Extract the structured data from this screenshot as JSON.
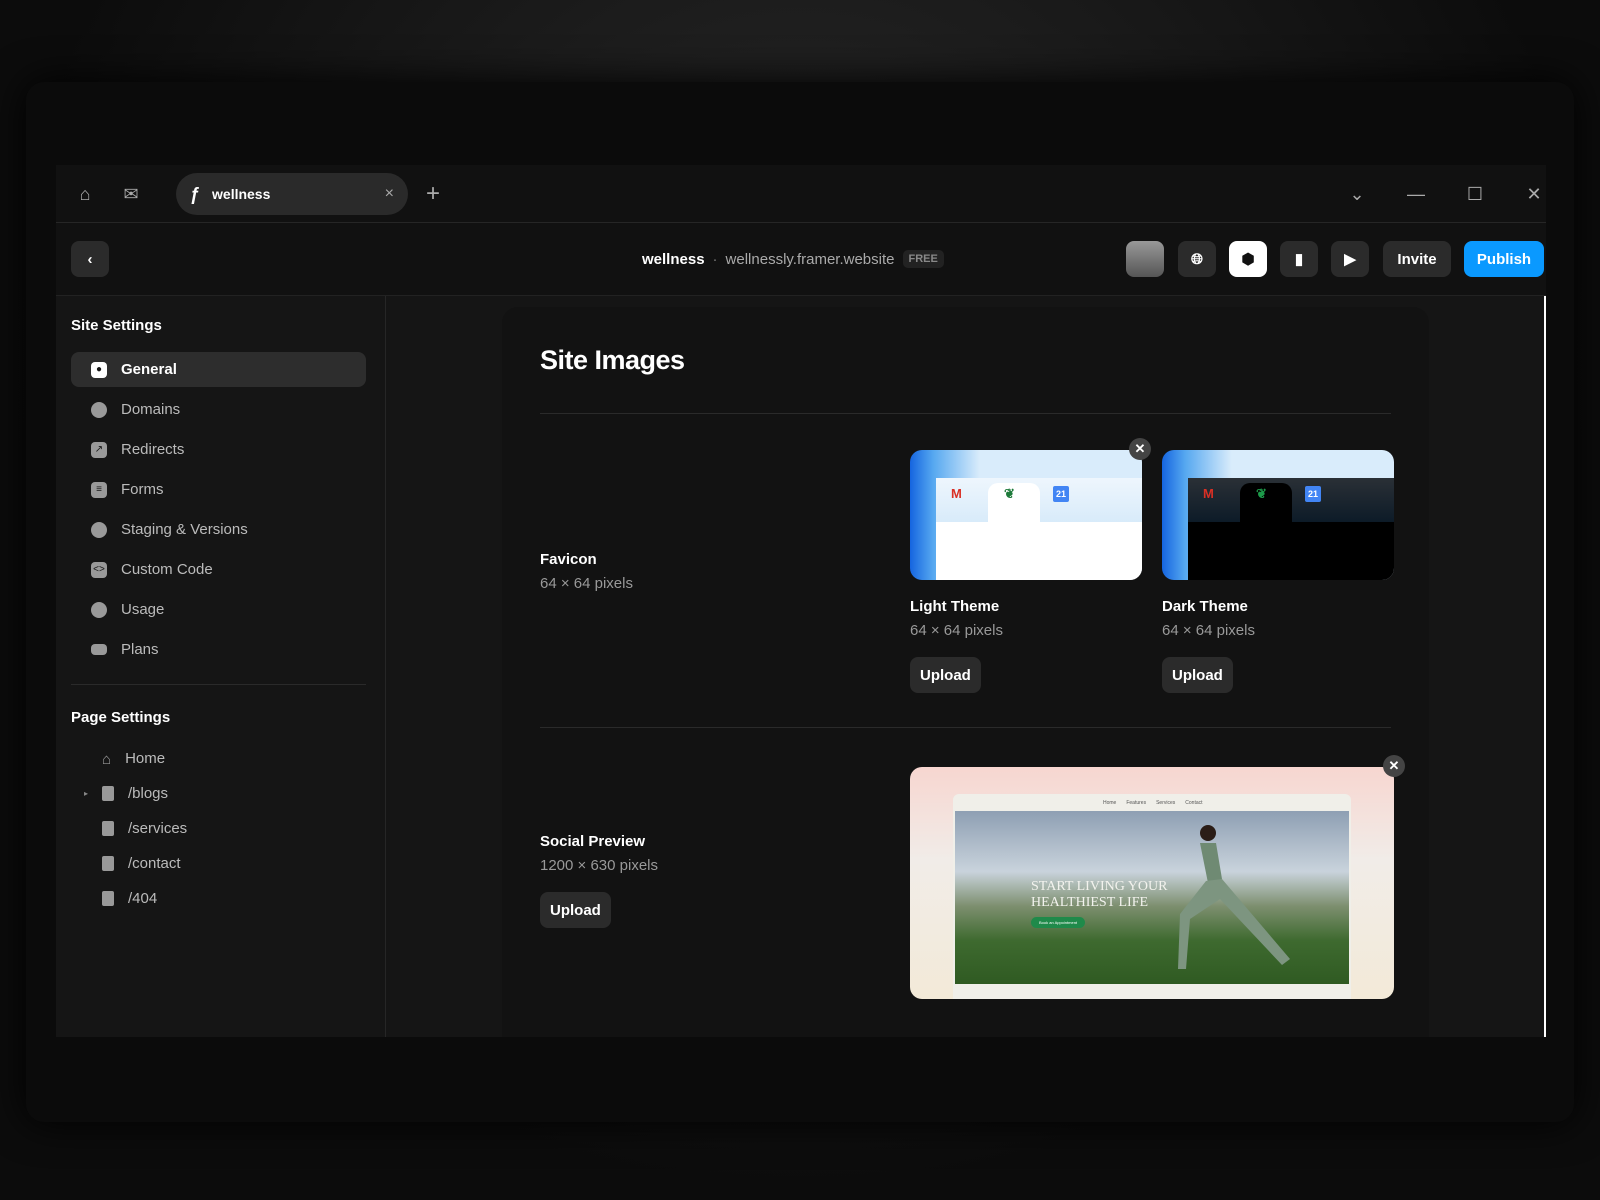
{
  "browser": {
    "tab_title": "wellness",
    "tab_close": "×",
    "new_tab": "+"
  },
  "toolbar": {
    "project": "wellness",
    "separator": "·",
    "domain": "wellnessly.framer.website",
    "plan_badge": "FREE",
    "invite": "Invite",
    "publish": "Publish",
    "accent": "#0a99ff"
  },
  "sidebar": {
    "site_heading": "Site Settings",
    "items": [
      {
        "label": "General",
        "icon": "gear-icon"
      },
      {
        "label": "Domains",
        "icon": "globe-icon"
      },
      {
        "label": "Redirects",
        "icon": "redirect-icon"
      },
      {
        "label": "Forms",
        "icon": "form-icon"
      },
      {
        "label": "Staging & Versions",
        "icon": "clock-icon"
      },
      {
        "label": "Custom Code",
        "icon": "code-icon"
      },
      {
        "label": "Usage",
        "icon": "gauge-icon"
      },
      {
        "label": "Plans",
        "icon": "card-icon"
      }
    ],
    "page_heading": "Page Settings",
    "pages": [
      {
        "label": "Home"
      },
      {
        "label": "/blogs"
      },
      {
        "label": "/services"
      },
      {
        "label": "/contact"
      },
      {
        "label": "/404"
      }
    ]
  },
  "main": {
    "title": "Site Images",
    "favicon": {
      "label": "Favicon",
      "size": "64 × 64 pixels",
      "light": {
        "label": "Light Theme",
        "size": "64 × 64 pixels",
        "upload": "Upload"
      },
      "dark": {
        "label": "Dark Theme",
        "size": "64 × 64 pixels",
        "upload": "Upload"
      },
      "calendar_day": "21",
      "gmail_letter": "M"
    },
    "social": {
      "label": "Social Preview",
      "size": "1200 × 630 pixels",
      "upload": "Upload",
      "preview": {
        "nav": [
          "Home",
          "Features",
          "Services",
          "Contact"
        ],
        "headline_1": "START LIVING YOUR",
        "headline_2": "HEALTHIEST LIFE",
        "cta": "Book an Appointment"
      }
    }
  }
}
